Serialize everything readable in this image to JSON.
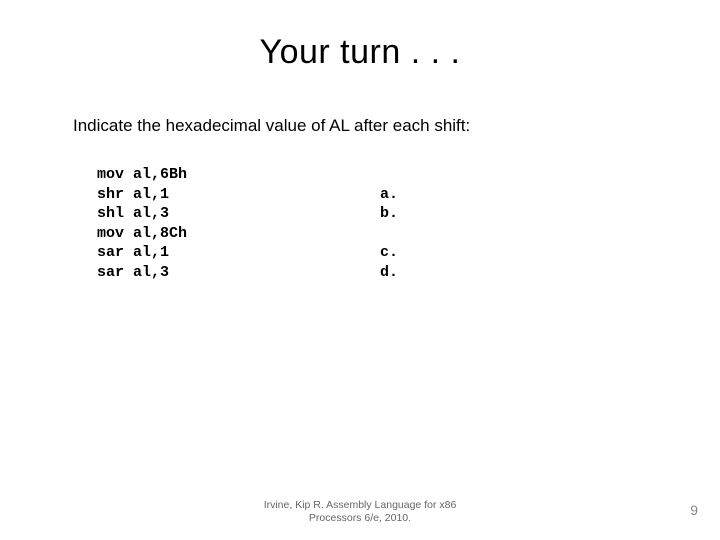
{
  "title": "Your turn . . .",
  "subtitle": "Indicate the hexadecimal value of AL after each shift:",
  "code": {
    "l1": "mov al,6Bh",
    "l2": "shr al,1",
    "l3": "shl al,3",
    "l4": "mov al,8Ch",
    "l5": "sar al,1",
    "l6": "sar al,3"
  },
  "labels": {
    "a": "a.",
    "b": "b.",
    "c": "c.",
    "d": "d."
  },
  "citation_line1": "Irvine, Kip R. Assembly Language for x86",
  "citation_line2": "Processors 6/e, 2010.",
  "page_number": "9"
}
